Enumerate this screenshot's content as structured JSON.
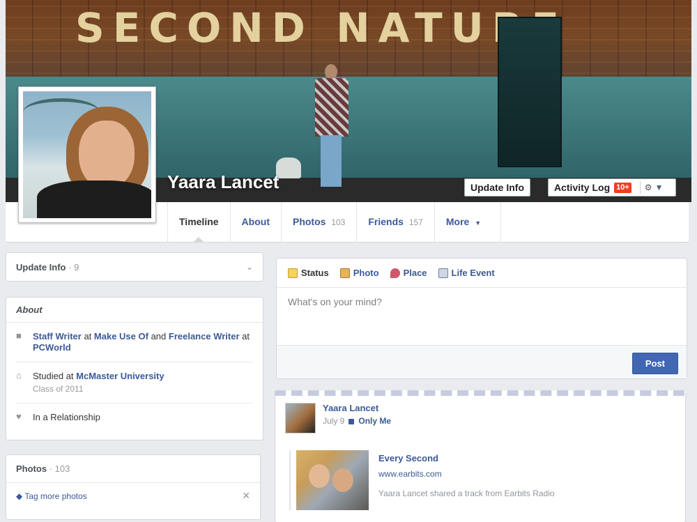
{
  "cover": {
    "sign_text": "SECOND NATURE",
    "name": "Yaara Lancet",
    "update_info_label": "Update Info",
    "activity_log_label": "Activity Log",
    "activity_badge": "10+"
  },
  "nav": {
    "tabs": [
      {
        "label": "Timeline",
        "count": ""
      },
      {
        "label": "About",
        "count": ""
      },
      {
        "label": "Photos",
        "count": "103"
      },
      {
        "label": "Friends",
        "count": "157"
      },
      {
        "label": "More",
        "count": ""
      }
    ]
  },
  "sidebar": {
    "update_info": {
      "label": "Update Info",
      "sep": " · ",
      "count": "9"
    },
    "about": {
      "title": "About",
      "work": {
        "role1": "Staff Writer",
        "at1": " at ",
        "org1": "Make Use Of",
        "and": " and ",
        "role2": "Freelance Writer",
        "at2": " at ",
        "org2": "PCWorld"
      },
      "education": {
        "prefix": "Studied at ",
        "school": "McMaster University",
        "class": "Class of 2011"
      },
      "relationship": "In a Relationship"
    },
    "photos": {
      "title": "Photos",
      "sep": " · ",
      "count": "103",
      "tag_label": "Tag more photos"
    }
  },
  "composer": {
    "tabs": [
      "Status",
      "Photo",
      "Place",
      "Life Event"
    ],
    "placeholder": "What's on your mind?",
    "post_label": "Post"
  },
  "story": {
    "author": "Yaara Lancet",
    "date": "July 9",
    "privacy": "Only Me",
    "attachment": {
      "title": "Every Second",
      "url": "www.earbits.com",
      "description": "Yaara Lancet shared a track from Earbits Radio"
    }
  }
}
